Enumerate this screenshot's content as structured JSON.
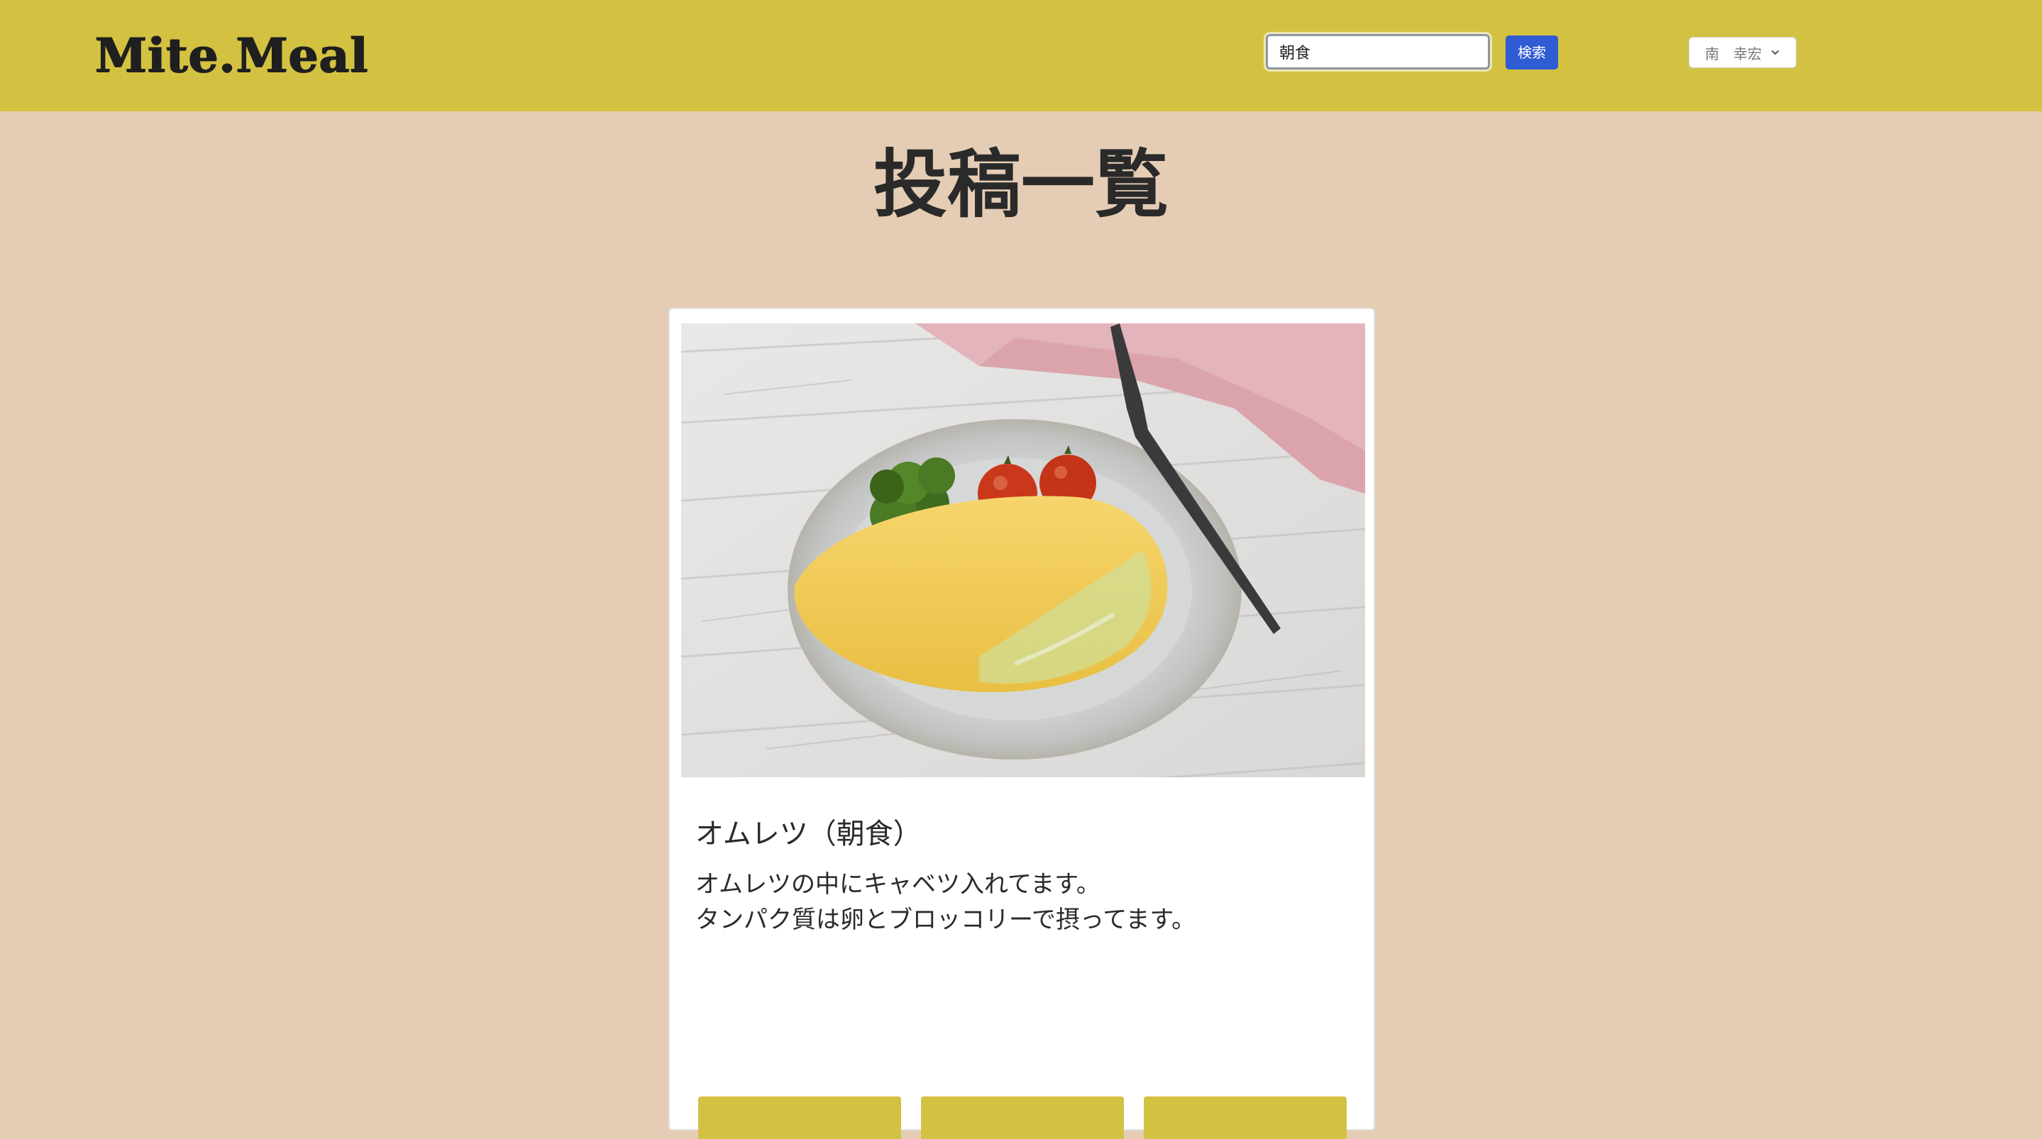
{
  "header": {
    "logo_text": "Mite.Meal",
    "search_value": "朝食",
    "search_button_label": "検索",
    "user_name": "南　幸宏",
    "user_menu_icon": "chevron-down-icon",
    "background_color": "#d3c242"
  },
  "main": {
    "page_title": "投稿一覧",
    "background_color": "#e5cdb5"
  },
  "post": {
    "image_description_icon": "omelette-photo",
    "title": "オムレツ（朝食）",
    "body_lines": [
      "オムレツの中にキャベツ入れてます。",
      "タンパク質は卵とブロッコリーで摂ってます。"
    ]
  },
  "colors": {
    "accent": "#d3c242",
    "search_button": "#2f5bd3"
  }
}
